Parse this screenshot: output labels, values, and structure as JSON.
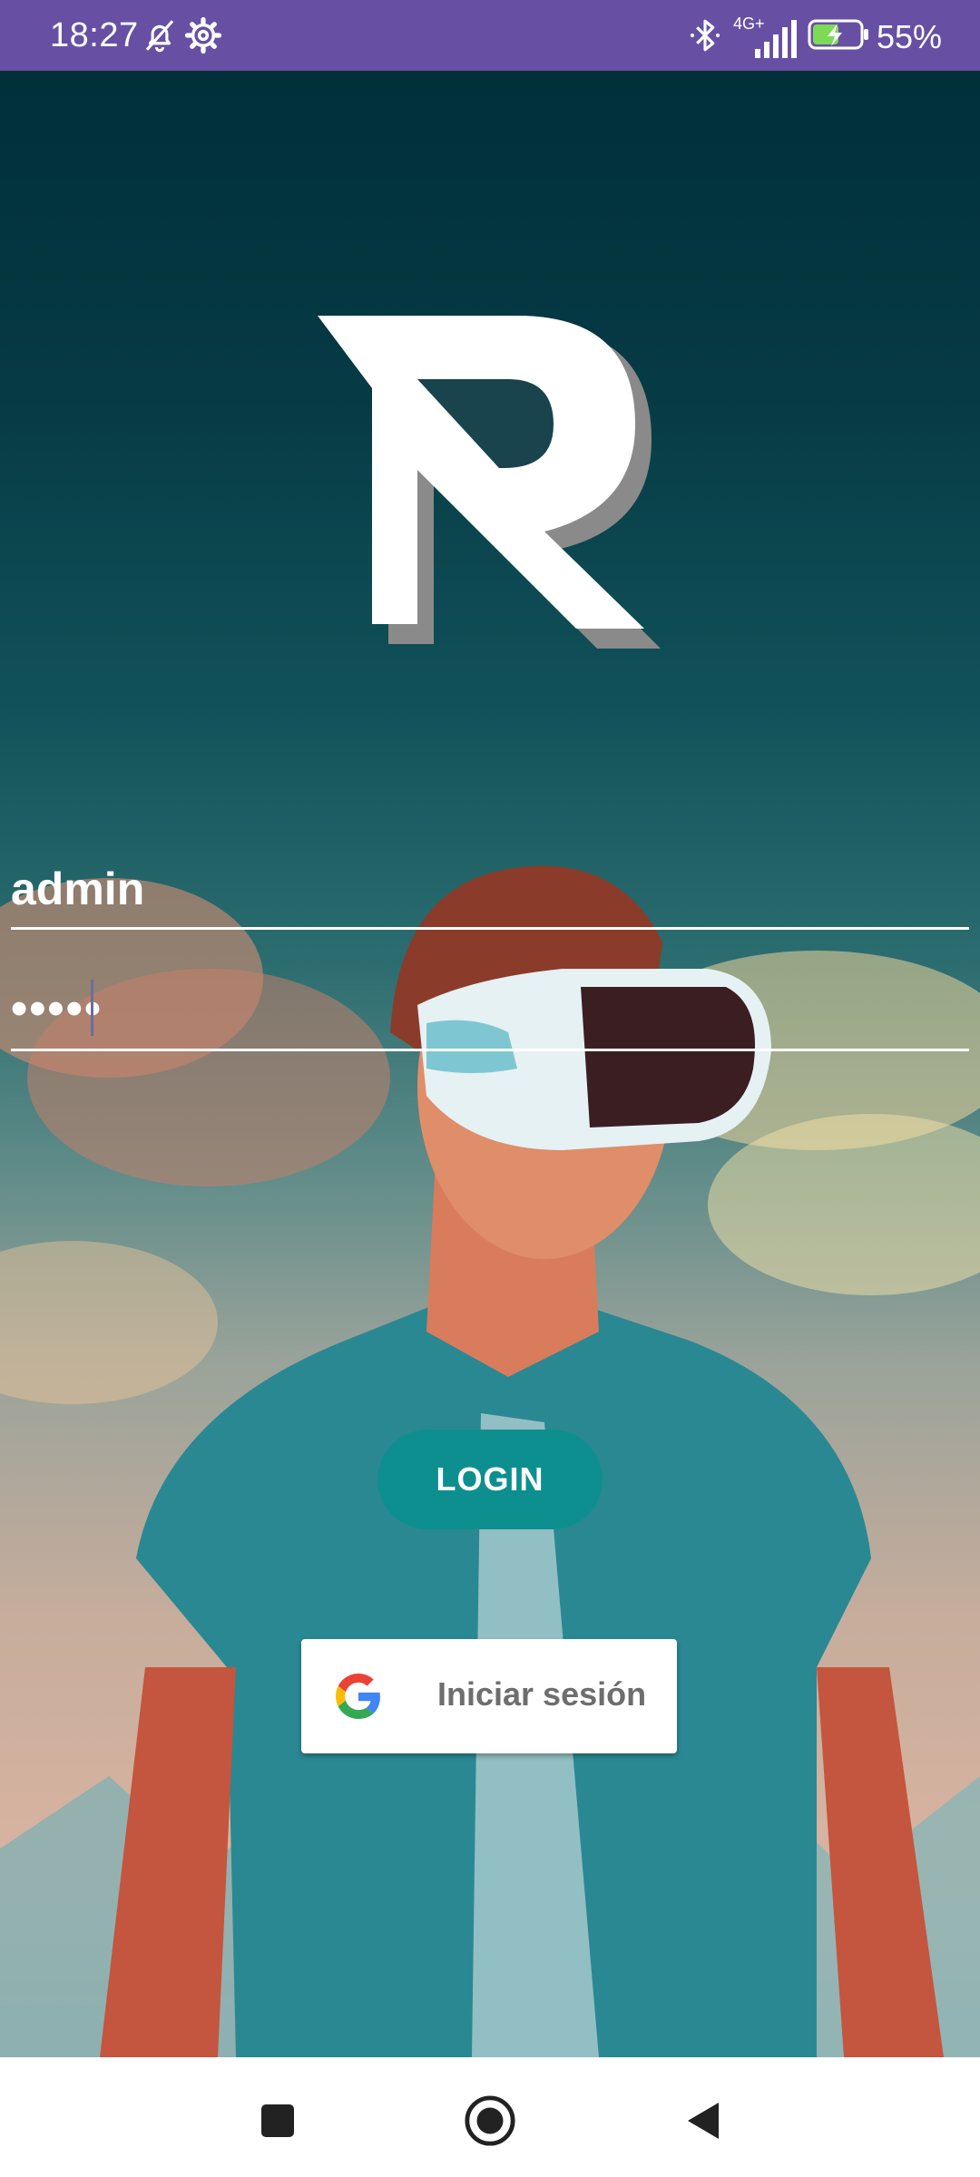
{
  "status_bar": {
    "time": "18:27",
    "left_icons": [
      "bell-off-icon",
      "settings-gear-icon"
    ],
    "right_icons": [
      "bluetooth-icon",
      "signal-4g-icon",
      "battery-charging-icon"
    ],
    "network": "4G+",
    "battery_percent": "55%",
    "background_color": "#6750A4"
  },
  "login": {
    "username_value": "admin",
    "password_value": "•••••",
    "login_label": "LOGIN",
    "google_label": "Iniciar sesión",
    "accent_color": "#0E8F8F"
  },
  "nav_bar": {
    "buttons": [
      "recents-square-icon",
      "home-circle-icon",
      "back-triangle-icon"
    ]
  }
}
